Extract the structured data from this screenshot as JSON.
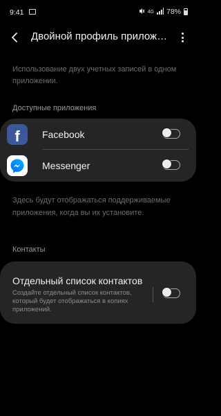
{
  "status_bar": {
    "time": "9:41",
    "network": "4G",
    "battery": "78%"
  },
  "app_bar": {
    "title": "Двойной профиль приложений"
  },
  "description": "Использование двух учетных записей в одном приложении.",
  "available_apps": {
    "header": "Доступные приложения",
    "items": [
      {
        "label": "Facebook",
        "icon": "facebook-icon",
        "enabled": false
      },
      {
        "label": "Messenger",
        "icon": "messenger-icon",
        "enabled": false
      }
    ],
    "note": "Здесь будут отображаться поддерживаемые приложения, когда вы их установите."
  },
  "contacts": {
    "header": "Контакты",
    "separate_list": {
      "title": "Отдельный список контактов",
      "subtitle": "Создайте отдельный список контактов, который будет отображаться в копиях приложений.",
      "enabled": false
    }
  },
  "colors": {
    "background": "#000000",
    "card": "#252525",
    "facebook": "#3b5998",
    "messenger_gradient": [
      "#00b2ff",
      "#006aff"
    ]
  }
}
